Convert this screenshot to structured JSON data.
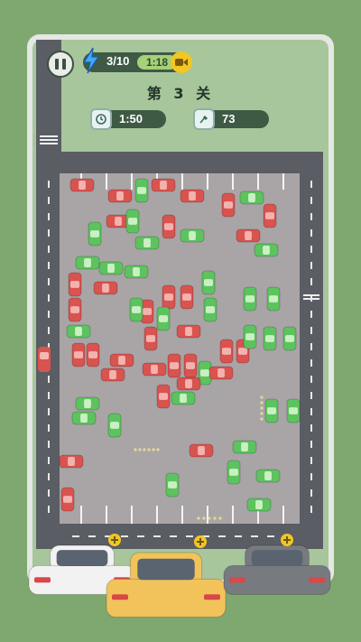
{
  "energy": {
    "count": "3/10",
    "timer": "1:18",
    "icon": "lightning-icon",
    "refill_icon": "video-icon"
  },
  "level": {
    "title": "第 3 关"
  },
  "stats": {
    "time": {
      "value": "1:50",
      "icon": "clock-icon"
    },
    "moves": {
      "value": "73",
      "icon": "broom-icon"
    }
  },
  "colors": {
    "background": "#7fa870",
    "panel": "#a8c69c",
    "road": "#5a5d63",
    "parking_lot": "#a9a5a7",
    "car_red": "#d9534f",
    "car_green": "#5cc35e",
    "car_white": "#f2f2f2",
    "car_yellow": "#f2c35b",
    "car_grey": "#777b80"
  },
  "cars": [
    {
      "color": "red"
    },
    {
      "color": "red"
    },
    {
      "color": "red"
    },
    {
      "color": "red"
    },
    {
      "color": "red"
    },
    {
      "color": "red"
    },
    {
      "color": "red"
    },
    {
      "color": "red"
    },
    {
      "color": "green"
    },
    {
      "color": "green"
    },
    {
      "color": "green"
    },
    {
      "color": "green"
    },
    {
      "color": "green"
    },
    {
      "color": "green"
    },
    {
      "color": "green"
    },
    {
      "color": "green"
    },
    {
      "color": "red"
    },
    {
      "color": "red"
    },
    {
      "color": "red"
    },
    {
      "color": "red"
    },
    {
      "color": "red"
    },
    {
      "color": "red"
    },
    {
      "color": "red"
    },
    {
      "color": "red"
    },
    {
      "color": "green"
    },
    {
      "color": "green"
    },
    {
      "color": "green"
    },
    {
      "color": "green"
    },
    {
      "color": "green"
    },
    {
      "color": "green"
    },
    {
      "color": "green"
    },
    {
      "color": "green"
    },
    {
      "color": "red"
    },
    {
      "color": "red"
    },
    {
      "color": "red"
    },
    {
      "color": "red"
    },
    {
      "color": "red"
    },
    {
      "color": "red"
    },
    {
      "color": "red"
    },
    {
      "color": "red"
    },
    {
      "color": "green"
    },
    {
      "color": "green"
    },
    {
      "color": "green"
    },
    {
      "color": "green"
    },
    {
      "color": "green"
    },
    {
      "color": "green"
    },
    {
      "color": "green"
    },
    {
      "color": "green"
    },
    {
      "color": "red"
    },
    {
      "color": "red"
    },
    {
      "color": "red"
    },
    {
      "color": "red"
    },
    {
      "color": "red"
    },
    {
      "color": "red"
    },
    {
      "color": "red"
    },
    {
      "color": "red"
    },
    {
      "color": "green"
    },
    {
      "color": "green"
    },
    {
      "color": "green"
    },
    {
      "color": "green"
    },
    {
      "color": "green"
    },
    {
      "color": "green"
    },
    {
      "color": "green"
    },
    {
      "color": "green"
    }
  ],
  "queue_cars": [
    {
      "color": "white"
    },
    {
      "color": "yellow"
    },
    {
      "color": "grey"
    }
  ]
}
